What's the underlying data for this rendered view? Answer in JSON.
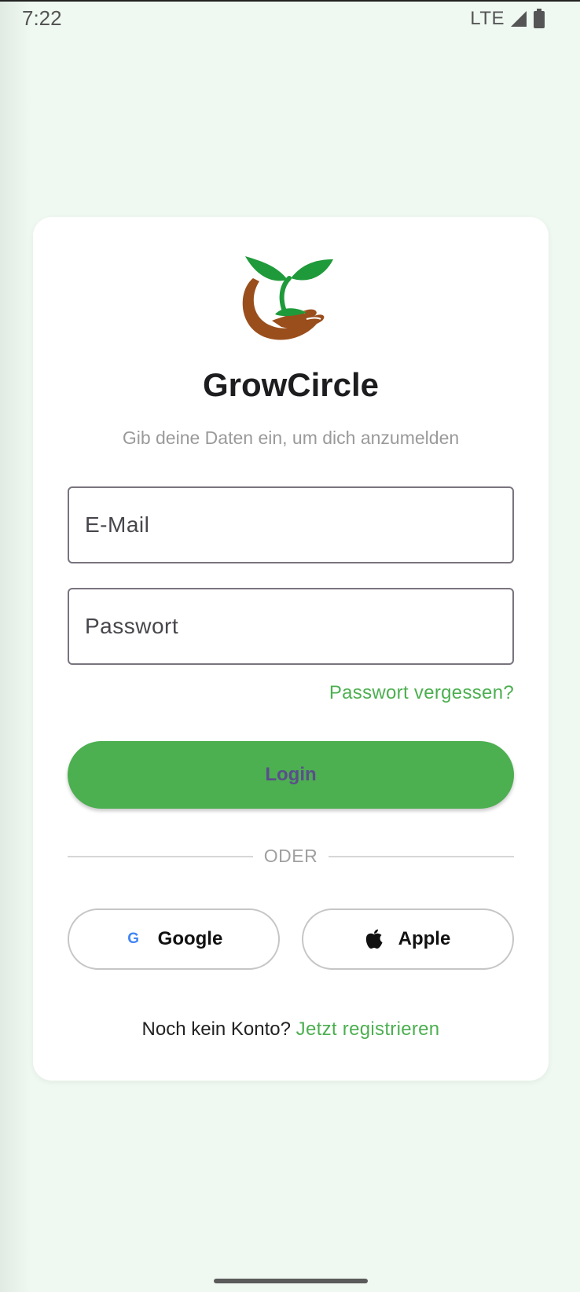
{
  "status_bar": {
    "time": "7:22",
    "network": "LTE",
    "signal_icon": "cell-signal-icon",
    "battery_icon": "battery-icon"
  },
  "login_card": {
    "logo_icon": "sprout-in-hand-logo",
    "app_name": "GrowCircle",
    "subtitle": "Gib deine Daten ein, um dich anzumelden",
    "email_placeholder": "E-Mail",
    "password_placeholder": "Passwort",
    "forgot_password": "Passwort vergessen?",
    "login_button": "Login",
    "divider_text": "ODER",
    "google_button": {
      "icon": "G",
      "label": "Google"
    },
    "apple_button": {
      "icon": "apple-icon",
      "label": "Apple"
    },
    "signup_prompt": "Noch kein Konto?",
    "signup_link": "Jetzt registrieren"
  },
  "colors": {
    "background": "#eff9f1",
    "primary_green": "#4caf50",
    "login_text": "#5b4e8c",
    "logo_leaf": "#1f9a3a",
    "logo_hand": "#9a4e1c"
  }
}
